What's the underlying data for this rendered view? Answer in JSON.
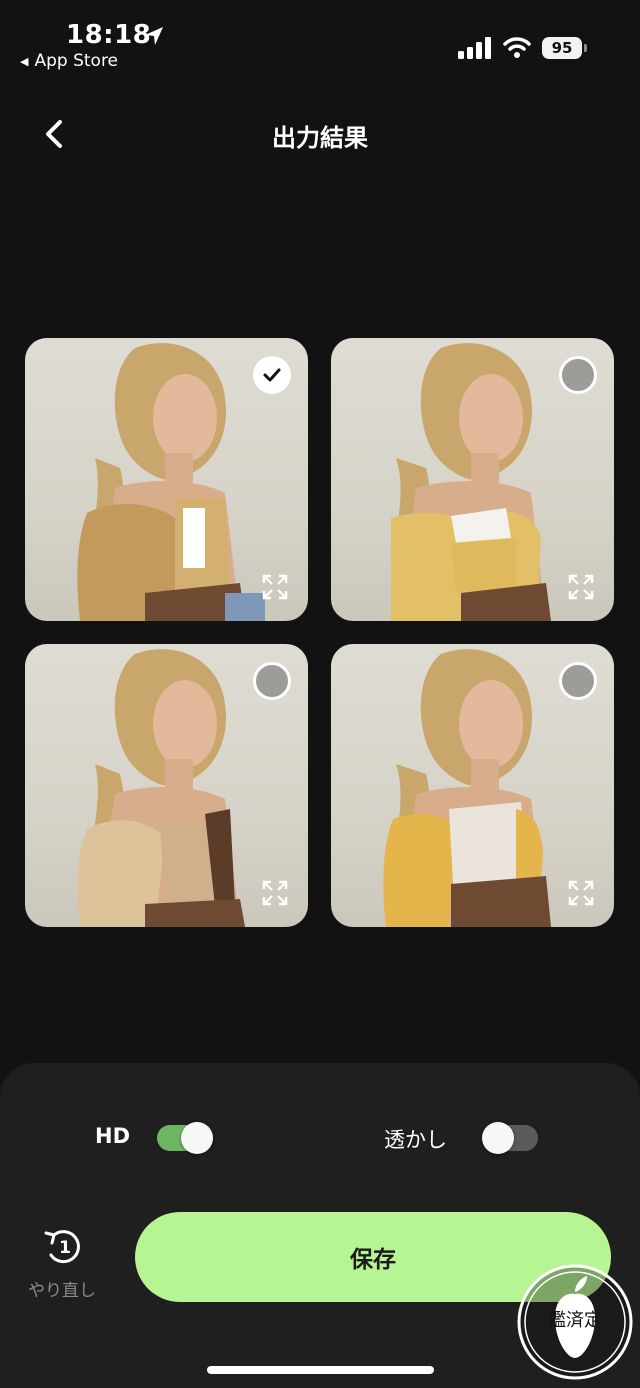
{
  "status_bar": {
    "time": "18:18",
    "back_app": "App Store",
    "battery": "95"
  },
  "nav": {
    "back_icon": "chevron-left-icon",
    "title": "出力結果"
  },
  "results": [
    {
      "selected": true
    },
    {
      "selected": false
    },
    {
      "selected": false
    },
    {
      "selected": false
    }
  ],
  "options": {
    "hd_label": "HD",
    "hd_on": true,
    "watermark_label": "透かし",
    "watermark_on": false
  },
  "actions": {
    "redo_label": "やり直し",
    "redo_badge": "1",
    "save_label": "保存"
  },
  "stamp": {
    "text": "鑑済定"
  },
  "colors": {
    "background": "#121212",
    "panel": "#1f1f1f",
    "save_button": "#b7f594",
    "toggle_on": "#6db463",
    "toggle_off": "#5a5a5a"
  }
}
